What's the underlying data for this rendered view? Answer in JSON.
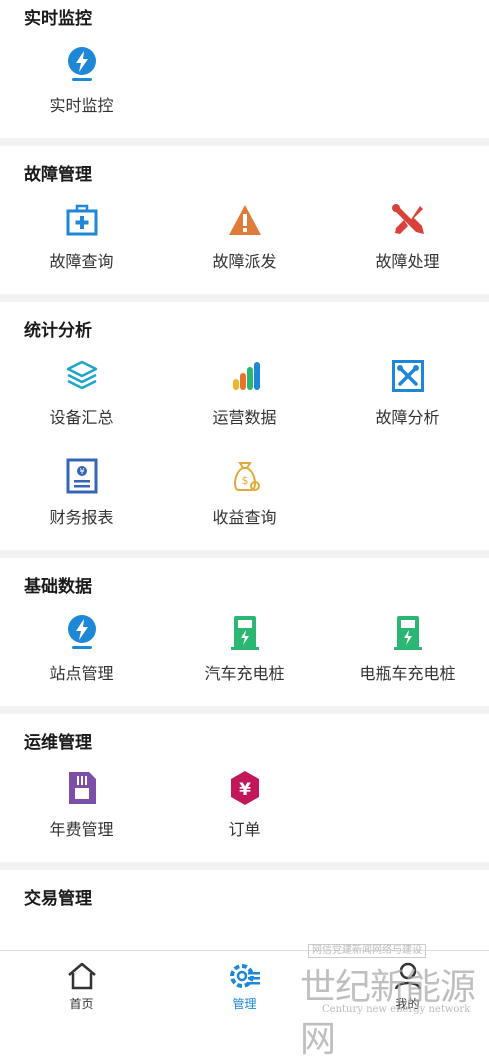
{
  "sections": [
    {
      "title": "实时监控",
      "items": [
        {
          "label": "实时监控",
          "icon": "lightning-pin-icon"
        }
      ]
    },
    {
      "title": "故障管理",
      "items": [
        {
          "label": "故障查询",
          "icon": "first-aid-kit-icon"
        },
        {
          "label": "故障派发",
          "icon": "warning-triangle-icon"
        },
        {
          "label": "故障处理",
          "icon": "tools-icon"
        }
      ]
    },
    {
      "title": "统计分析",
      "items": [
        {
          "label": "设备汇总",
          "icon": "layers-icon"
        },
        {
          "label": "运营数据",
          "icon": "bar-chart-icon"
        },
        {
          "label": "故障分析",
          "icon": "wrench-box-icon"
        },
        {
          "label": "财务报表",
          "icon": "finance-report-icon"
        },
        {
          "label": "收益查询",
          "icon": "money-bag-icon"
        }
      ]
    },
    {
      "title": "基础数据",
      "items": [
        {
          "label": "站点管理",
          "icon": "lightning-pin-icon"
        },
        {
          "label": "汽车充电桩",
          "icon": "charging-pile-icon"
        },
        {
          "label": "电瓶车充电桩",
          "icon": "charging-pile-icon"
        }
      ]
    },
    {
      "title": "运维管理",
      "items": [
        {
          "label": "年费管理",
          "icon": "sim-card-icon"
        },
        {
          "label": "订单",
          "icon": "yuan-badge-icon"
        }
      ]
    },
    {
      "title": "交易管理",
      "items": []
    }
  ],
  "tabbar": {
    "home": "首页",
    "manage": "管理",
    "mine": "我的"
  },
  "watermark": {
    "small": "网信党建新闻网络与建设",
    "big": "世纪新能源网",
    "en": "Century new energy network"
  },
  "colors": {
    "accent": "#1e88d6",
    "green": "#2bb673",
    "red": "#d9423a",
    "orange": "#e07b39",
    "purple": "#7b4fa8",
    "magenta": "#c2185b"
  }
}
